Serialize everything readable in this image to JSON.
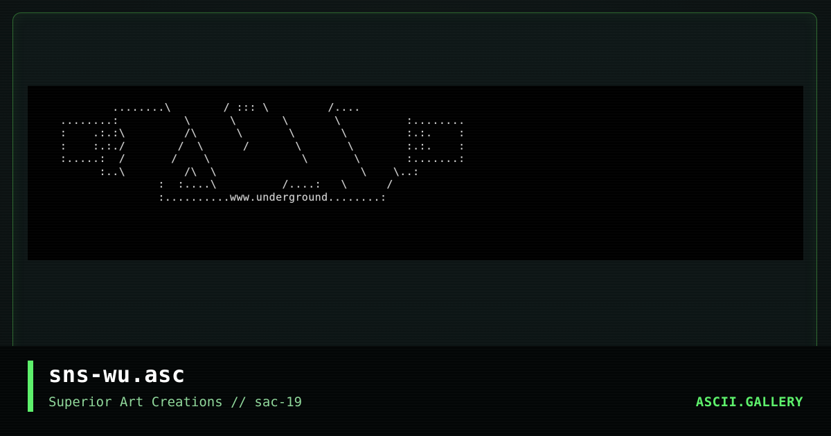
{
  "card": {
    "filename": "sns-wu.asc",
    "byline": "Superior Art Creations // sac-19",
    "site": "ASCII.GALLERY",
    "accent_color": "#5cf06a",
    "border_color": "#2e6a30"
  },
  "art": {
    "text": "          ........\\        / ::: \\         /....\n  ........:          \\      \\       \\       \\          :........\n  :    .:.:\\         /\\      \\       \\       \\         :.:.    :\n  :    :.:./        /  \\      /       \\       \\        :.:.    :\n  :.....:  /       /    \\              \\       \\       :.......:\n        :..\\         /\\  \\                      \\    \\..:\n                 :  :....\\          /....:   \\      /\n                 :..........www.underground........:"
  }
}
